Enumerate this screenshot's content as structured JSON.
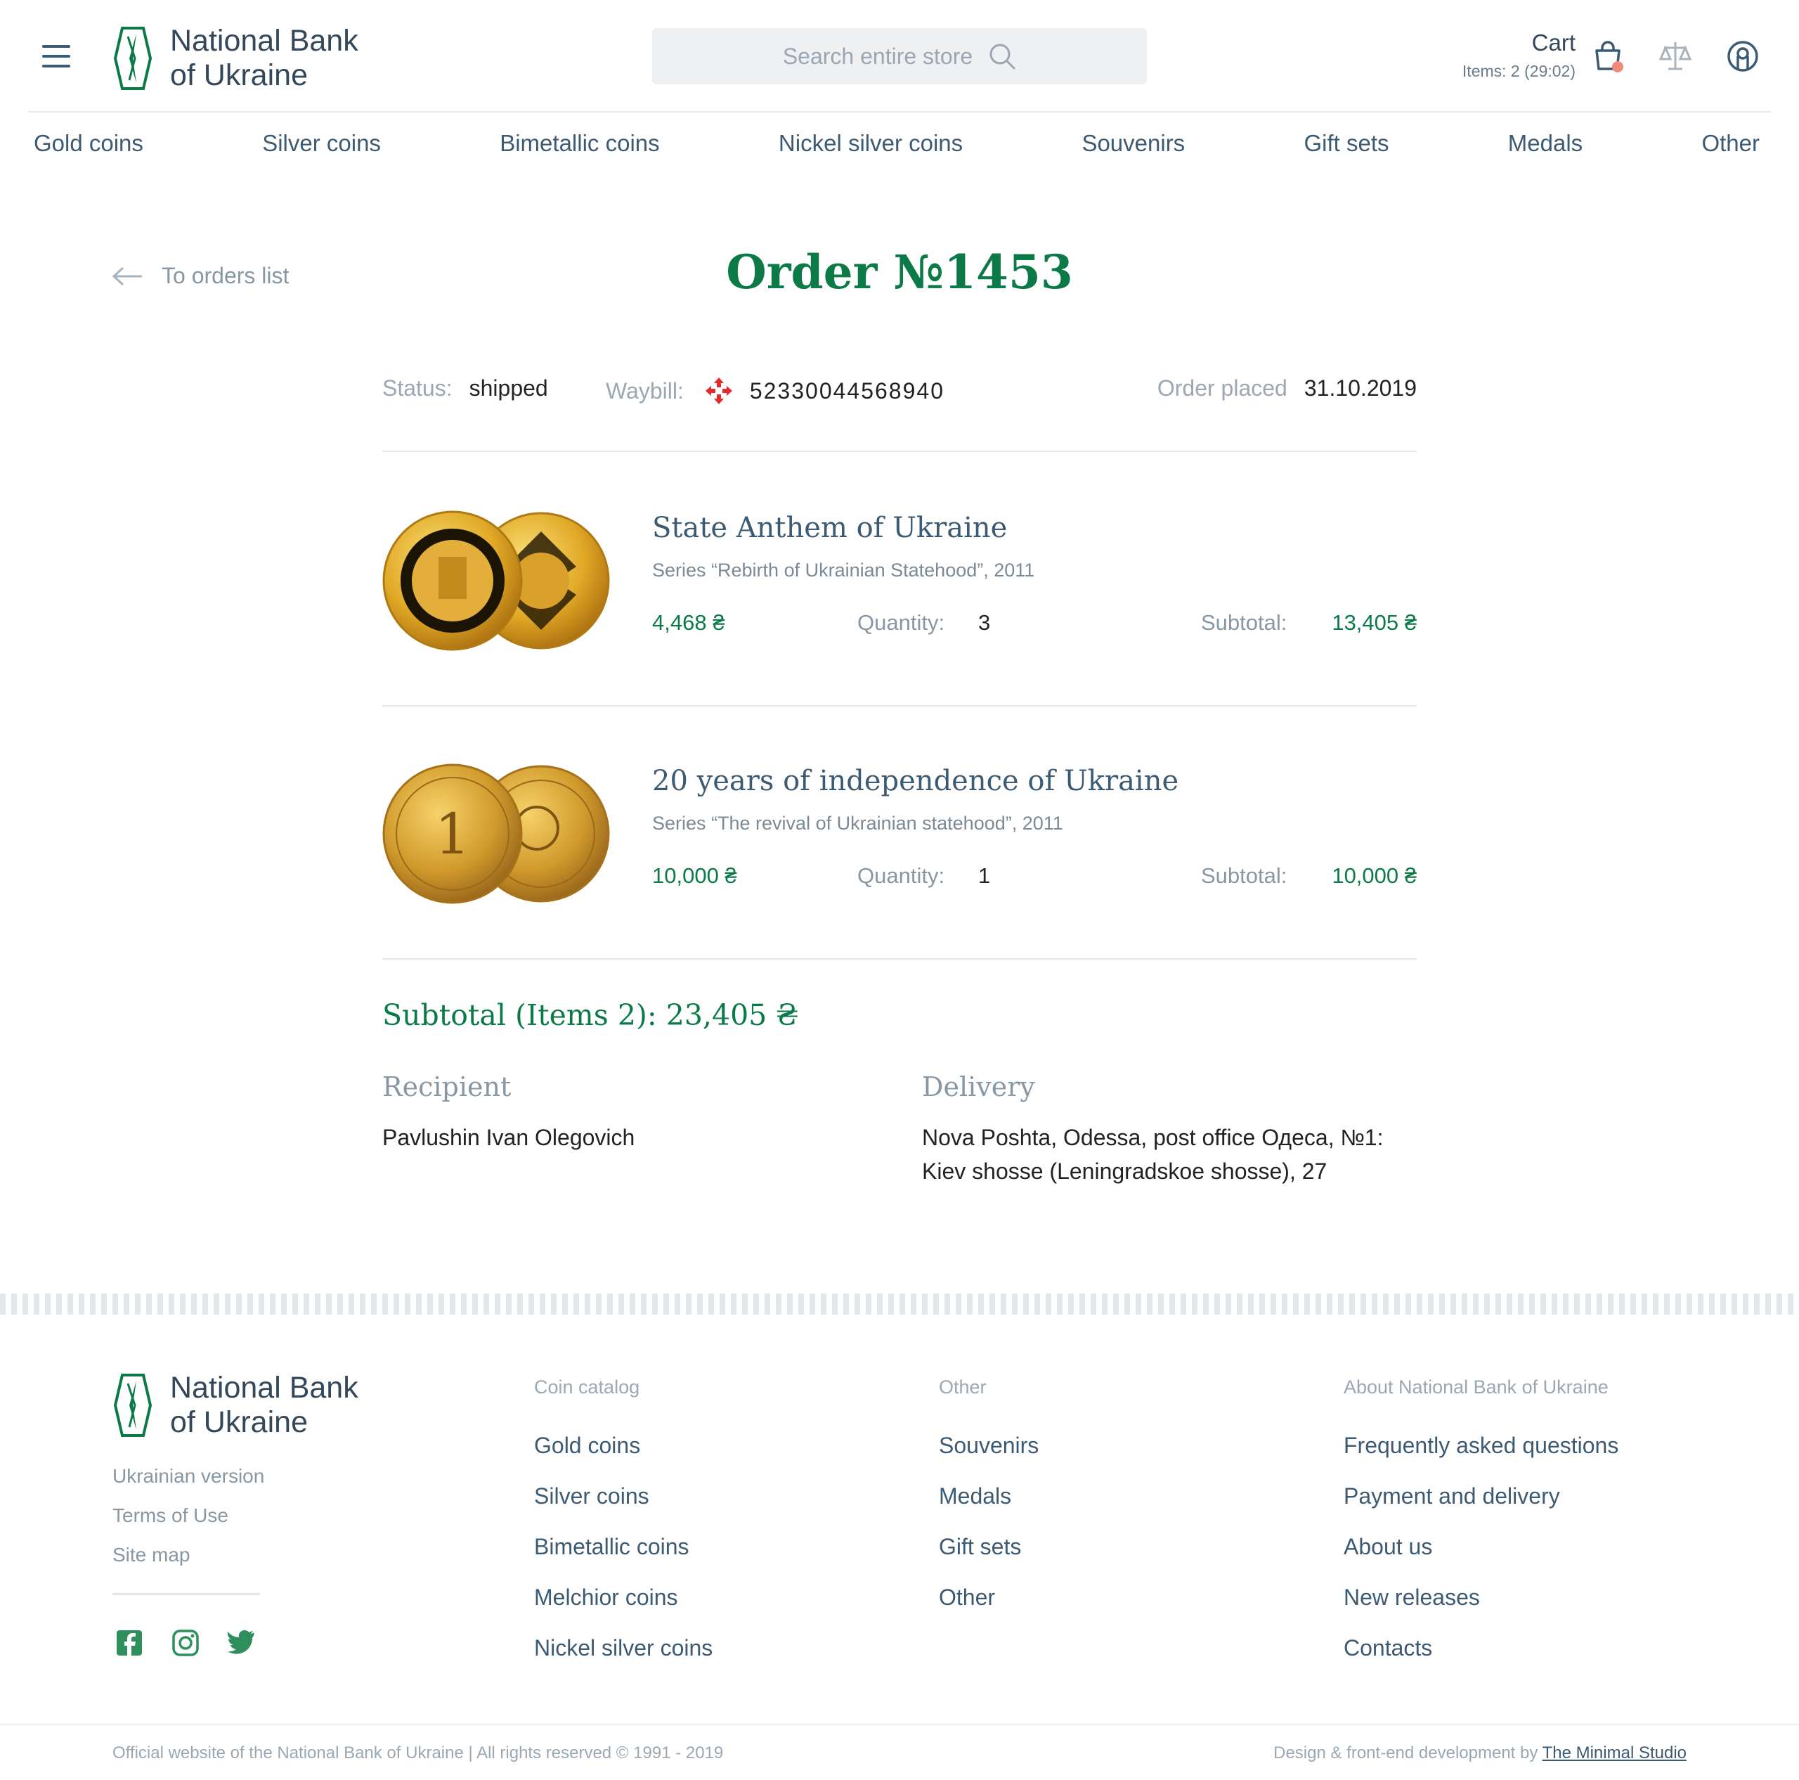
{
  "header": {
    "logo_line1": "National Bank",
    "logo_line2": "of Ukraine",
    "search_placeholder": "Search entire store",
    "cart_title": "Cart",
    "cart_items": "Items: 2 (29:02)"
  },
  "nav": [
    "Gold coins",
    "Silver coins",
    "Bimetallic coins",
    "Nickel silver coins",
    "Souvenirs",
    "Gift sets",
    "Medals",
    "Other"
  ],
  "order": {
    "back_label": "To orders list",
    "title": "Order №1453",
    "status_label": "Status:",
    "status_value": "shipped",
    "waybill_label": "Waybill:",
    "waybill_value": "52330044568940",
    "placed_label": "Order placed",
    "placed_value": "31.10.2019"
  },
  "items": [
    {
      "name": "State Anthem of Ukraine",
      "series": "Series “Rebirth of Ukrainian Statehood”, 2011",
      "price": "4,468 ₴",
      "quantity_label": "Quantity:",
      "quantity": "3",
      "subtotal_label": "Subtotal:",
      "subtotal": "13,405 ₴"
    },
    {
      "name": "20 years of independence of Ukraine",
      "series": "Series “The revival of Ukrainian statehood”, 2011",
      "price": "10,000 ₴",
      "quantity_label": "Quantity:",
      "quantity": "1",
      "subtotal_label": "Subtotal:",
      "subtotal": "10,000 ₴"
    }
  ],
  "summary": {
    "total": "Subtotal (Items 2): 23,405 ₴",
    "recipient_heading": "Recipient",
    "recipient_name": "Pavlushin Ivan Olegovich",
    "delivery_heading": "Delivery",
    "delivery_line1": "Nova Poshta, Odessa, post office Одеса, №1:",
    "delivery_line2": "Kiev shosse (Leningradskoe shosse), 27"
  },
  "footer": {
    "small_links": [
      "Ukrainian version",
      "Terms of Use",
      "Site map"
    ],
    "columns": [
      {
        "heading": "Coin catalog",
        "links": [
          "Gold coins",
          "Silver coins",
          "Bimetallic coins",
          "Melchior coins",
          "Nickel silver coins"
        ]
      },
      {
        "heading": "Other",
        "links": [
          "Souvenirs",
          "Medals",
          "Gift sets",
          "Other"
        ]
      },
      {
        "heading": "About National Bank of Ukraine",
        "links": [
          "Frequently asked questions",
          "Payment and delivery",
          "About us",
          "New releases",
          "Contacts"
        ]
      }
    ],
    "social_icons": [
      "facebook-icon",
      "instagram-icon",
      "twitter-icon"
    ],
    "copyright": "Official website of the National Bank of Ukraine | All rights reserved © 1991 - 2019",
    "credits_prefix": "Design & front-end development by",
    "credits_link": "The Minimal Studio"
  },
  "colors": {
    "brand_green": "#0c7a47",
    "nav_text": "#3d5a73",
    "muted": "#8797a4",
    "cart_badge": "#f08a7a"
  }
}
